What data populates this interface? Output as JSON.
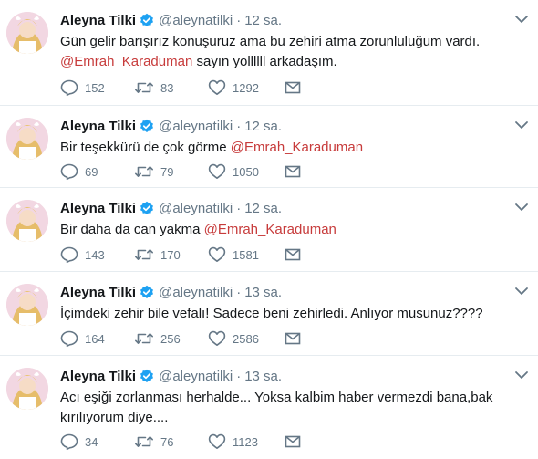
{
  "accent_color": "#c73b3b",
  "verified_color": "#1da1f2",
  "tweets": [
    {
      "name": "Aleyna Tilki",
      "handle": "@aleynatilki",
      "separator": "·",
      "time": "12 sa.",
      "text_before": "Gün gelir barışırız konuşuruz ama bu zehiri atma zorunluluğum vardı.",
      "mention": "@Emrah_Karaduman",
      "text_after": " sayın yollllll arkadaşım.",
      "replies": "152",
      "retweets": "83",
      "likes": "1292"
    },
    {
      "name": "Aleyna Tilki",
      "handle": "@aleynatilki",
      "separator": "·",
      "time": "12 sa.",
      "text_before": "Bir teşekkürü de çok görme ",
      "mention": "@Emrah_Karaduman",
      "text_after": "",
      "replies": "69",
      "retweets": "79",
      "likes": "1050"
    },
    {
      "name": "Aleyna Tilki",
      "handle": "@aleynatilki",
      "separator": "·",
      "time": "12 sa.",
      "text_before": "Bir daha da can yakma ",
      "mention": "@Emrah_Karaduman",
      "text_after": "",
      "replies": "143",
      "retweets": "170",
      "likes": "1581"
    },
    {
      "name": "Aleyna Tilki",
      "handle": "@aleynatilki",
      "separator": "·",
      "time": "13 sa.",
      "text_before": "İçimdeki zehir bile vefalı! Sadece beni zehirledi. Anlıyor musunuz????",
      "mention": "",
      "text_after": "",
      "replies": "164",
      "retweets": "256",
      "likes": "2586"
    },
    {
      "name": "Aleyna Tilki",
      "handle": "@aleynatilki",
      "separator": "·",
      "time": "13 sa.",
      "text_before": "Acı eşiği zorlanması herhalde... Yoksa kalbim haber vermezdi bana,bak kırılıyorum diye....",
      "mention": "",
      "text_after": "",
      "replies": "34",
      "retweets": "76",
      "likes": "1123"
    }
  ]
}
